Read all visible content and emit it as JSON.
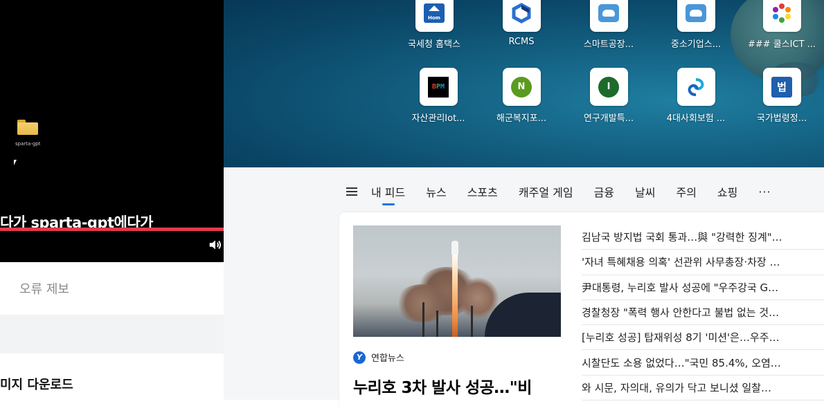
{
  "left_panel": {
    "desktop_icon_label": "sparta-gpt",
    "caption": "다가 sparta-gpt에다가",
    "report_label": "오류 제보",
    "download_label": "미지 다운로드"
  },
  "quick_links": [
    {
      "label": "국세청 홈택스",
      "icon": "hometax-icon"
    },
    {
      "label": "RCMS",
      "icon": "rcms-hexagon-icon"
    },
    {
      "label": "스마트공장...",
      "icon": "cloud-icon"
    },
    {
      "label": "중소기업스...",
      "icon": "cloud-icon"
    },
    {
      "label": "### 쿨스ICT ...",
      "icon": "color-wheel-icon"
    },
    {
      "label": "자산관리Iot...",
      "icon": "bpm-icon",
      "text": "BPM"
    },
    {
      "label": "해군복지포...",
      "icon": "n-circle-icon",
      "text": "N"
    },
    {
      "label": "연구개발특...",
      "icon": "i-circle-icon",
      "text": "I"
    },
    {
      "label": "4대사회보험 ...",
      "icon": "swirl-icon"
    },
    {
      "label": "국가법령정...",
      "icon": "law-icon",
      "text": "법"
    }
  ],
  "nav": {
    "items": [
      "내 피드",
      "뉴스",
      "스포츠",
      "캐주얼 게임",
      "금융",
      "날씨",
      "주의",
      "쇼핑"
    ],
    "active_index": 0,
    "more": "···"
  },
  "feature": {
    "source": "연합뉴스",
    "source_logo": "Y",
    "headline": "누리호 3차 발사 성공…\"비"
  },
  "news_list": [
    "김남국 방지법 국회 통과…與 \"강력한 징계\"…",
    "'자녀 특혜채용 의혹' 선관위 사무총장·차장 …",
    "尹대통령, 누리호 발사 성공에 \"우주강국 G…",
    "경찰청장 \"폭력 행사 안한다고 불법 없는 것…",
    "[누리호 성공] 탑재위성 8기 '미션'은…우주…",
    "시찰단도 소용 없었다…\"국민 85.4%, 오염…",
    "와 시문, 자의대, 유의가 닥고 보니셨 일찰…"
  ],
  "colors": {
    "progress": "#e23a4b",
    "nav_active": "#1a73e8",
    "hero_bg": "#135f80"
  }
}
